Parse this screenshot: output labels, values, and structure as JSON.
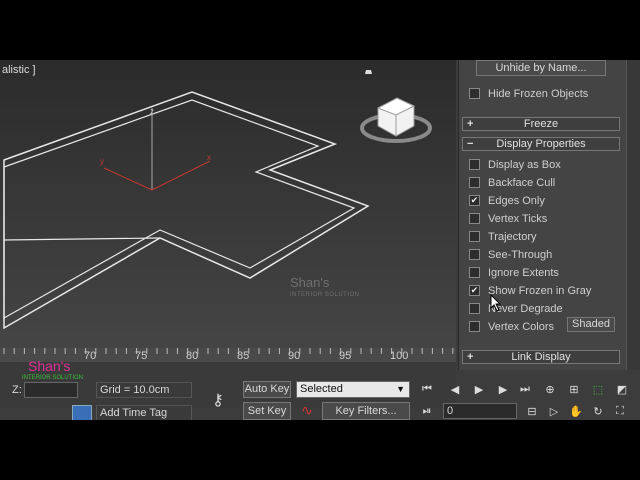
{
  "viewport": {
    "label": "alistic ]",
    "watermark_title": "Shan's",
    "watermark_sub": "INTERIOR SOLUTION"
  },
  "panel": {
    "unhide_by_name": "Unhide by Name...",
    "hide_frozen_objects": "Hide Frozen Objects",
    "freeze_rollout": "Freeze",
    "display_properties_rollout": "Display Properties",
    "options": [
      {
        "label": "Display as Box",
        "checked": false
      },
      {
        "label": "Backface Cull",
        "checked": false
      },
      {
        "label": "Edges Only",
        "checked": true
      },
      {
        "label": "Vertex Ticks",
        "checked": false
      },
      {
        "label": "Trajectory",
        "checked": false
      },
      {
        "label": "See-Through",
        "checked": false
      },
      {
        "label": "Ignore Extents",
        "checked": false
      },
      {
        "label": "Show Frozen in Gray",
        "checked": true
      },
      {
        "label": "Never Degrade",
        "checked": false
      },
      {
        "label": "Vertex Colors",
        "checked": false
      }
    ],
    "shaded_button": "Shaded",
    "link_display_rollout": "Link Display",
    "plus_sign": "+",
    "minus_sign": "−"
  },
  "timeline": {
    "ticks": [
      "70",
      "75",
      "80",
      "85",
      "90",
      "95",
      "100"
    ],
    "logo_title": "Shan's",
    "logo_sub": "INTERIOR SOLUTION"
  },
  "status": {
    "z_label": "Z:",
    "grid": "Grid = 10.0cm",
    "add_time_tag": "Add Time Tag",
    "auto_key": "Auto Key",
    "set_key": "Set Key",
    "selected_dropdown": "Selected",
    "key_filters": "Key Filters...",
    "frame_value": "0"
  }
}
